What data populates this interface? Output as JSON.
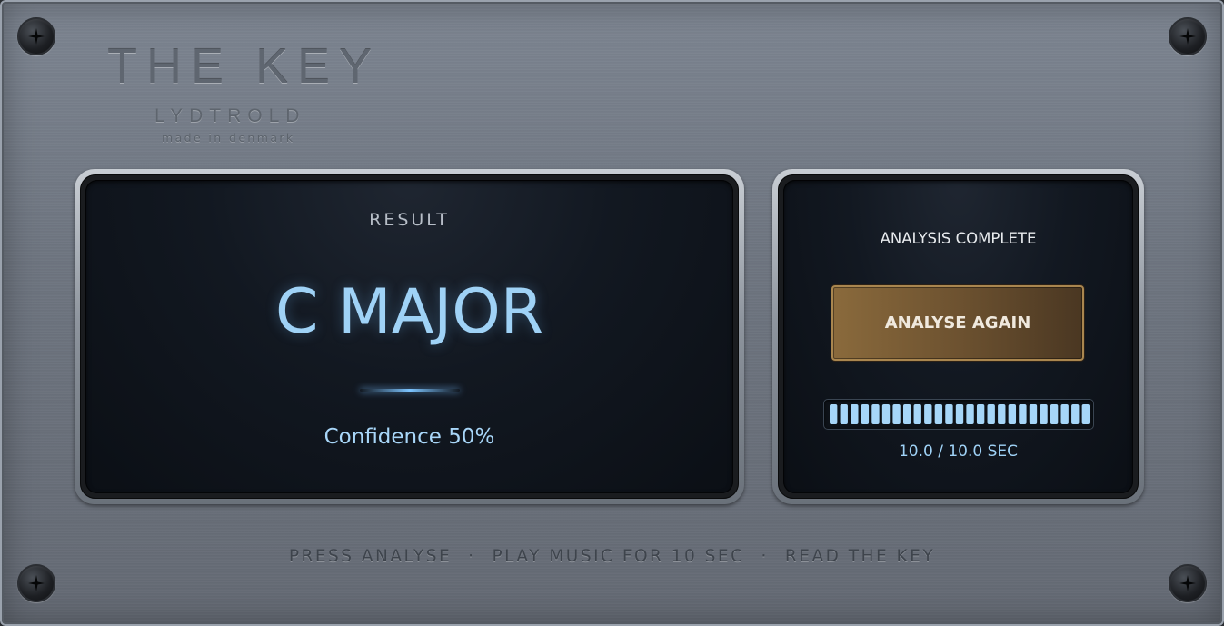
{
  "brand": {
    "title": "THE KEY",
    "maker": "LYDTROLD",
    "tagline": "made in denmark"
  },
  "result": {
    "label": "RESULT",
    "key": "C MAJOR",
    "confidence_text": "Confidence 50%",
    "confidence": 0.5
  },
  "analysis": {
    "status": "ANALYSIS COMPLETE",
    "button_label": "ANALYSE AGAIN",
    "time_text": "10.0 / 10.0 SEC",
    "progress": 1.0,
    "segments": 25
  },
  "footer": {
    "steps": [
      "PRESS ANALYSE",
      "PLAY MUSIC FOR 10 SEC",
      "READ THE KEY"
    ],
    "separator": "·"
  },
  "colors": {
    "accent": "#9fd2f6",
    "button": "#7a5c35",
    "meter_segment": "#a6d6f8"
  }
}
